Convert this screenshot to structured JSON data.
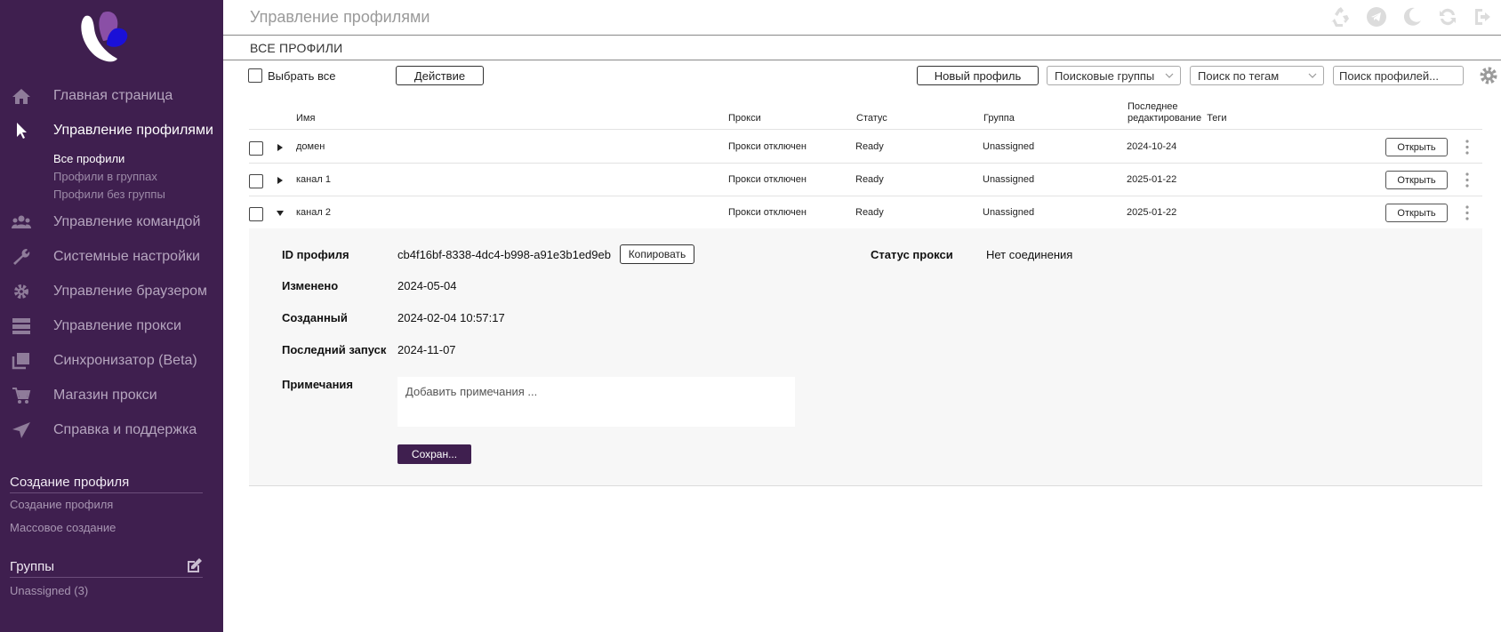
{
  "header": {
    "title": "Управление профилями",
    "icons": [
      "recycle-icon",
      "telegram-icon",
      "moon-icon",
      "refresh-icon",
      "logout-icon"
    ]
  },
  "sidebar": {
    "nav": [
      {
        "label": "Главная страница",
        "icon": "home-icon"
      },
      {
        "label": "Управление профилями",
        "icon": "cursor-icon",
        "active": true
      },
      {
        "label": "Управление командой",
        "icon": "team-icon"
      },
      {
        "label": "Системные настройки",
        "icon": "wrench-icon"
      },
      {
        "label": "Управление браузером",
        "icon": "gear-icon"
      },
      {
        "label": "Управление прокси",
        "icon": "server-icon"
      },
      {
        "label": "Синхронизатор (Beta)",
        "icon": "copy-icon"
      },
      {
        "label": "Магазин прокси",
        "icon": "cart-icon"
      },
      {
        "label": "Справка и поддержка",
        "icon": "send-icon"
      }
    ],
    "sub": [
      "Все профили",
      "Профили в группах",
      "Профили без группы"
    ],
    "create_section": {
      "title": "Создание профиля",
      "links": [
        "Создание профиля",
        "Массовое создание"
      ]
    },
    "groups_section": {
      "title": "Группы",
      "links": [
        "Unassigned (3)"
      ]
    }
  },
  "section": {
    "title": "ВСЕ ПРОФИЛИ"
  },
  "toolbar": {
    "select_all": "Выбрать все",
    "action": "Действие",
    "new_profile": "Новый профиль",
    "search_groups": "Поисковые группы",
    "search_tags": "Поиск по тегам",
    "search_profiles_placeholder": "Поиск профилей..."
  },
  "table": {
    "columns": {
      "name": "Имя",
      "proxy": "Прокси",
      "status": "Статус",
      "group": "Группа",
      "last_edit_1": "Последнее",
      "last_edit_2": "редактирование",
      "tags": "Теги"
    },
    "open_label": "Открыть",
    "rows": [
      {
        "name": "домен",
        "proxy": "Прокси отключен",
        "status": "Ready",
        "group": "Unassigned",
        "edited": "2024-10-24"
      },
      {
        "name": "канал 1",
        "proxy": "Прокси отключен",
        "status": "Ready",
        "group": "Unassigned",
        "edited": "2025-01-22"
      },
      {
        "name": "канал 2",
        "proxy": "Прокси отключен",
        "status": "Ready",
        "group": "Unassigned",
        "edited": "2025-01-22"
      }
    ]
  },
  "detail": {
    "id_label": "ID профиля",
    "id_value": "cb4f16bf-8338-4dc4-b998-a91e3b1ed9eb",
    "copy_label": "Копировать",
    "changed_label": "Изменено",
    "changed_value": "2024-05-04",
    "created_label": "Созданный",
    "created_value": "2024-02-04 10:57:17",
    "last_run_label": "Последний запуск",
    "last_run_value": "2024-11-07",
    "notes_label": "Примечания",
    "notes_placeholder": "Добавить примечания ...",
    "save_label": "Сохран...",
    "proxy_status_label": "Статус прокси",
    "proxy_status_value": "Нет соединения"
  },
  "colors": {
    "sidebar_bg": "#3f1f4f",
    "accent": "#3f1f4f"
  }
}
